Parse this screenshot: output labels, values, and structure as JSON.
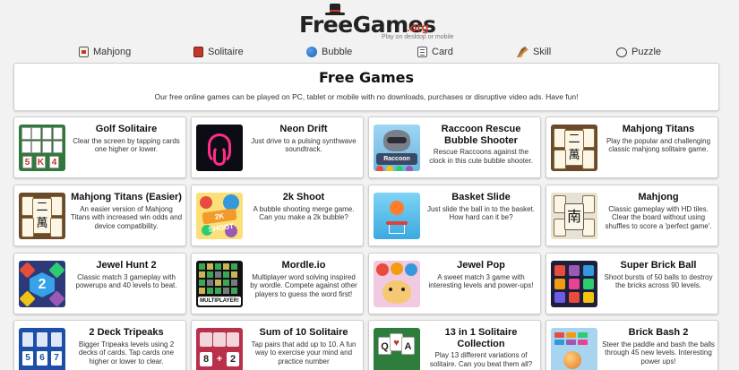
{
  "logo": {
    "main": "FreeGames",
    "ext": ".org",
    "tagline": "Play on desktop or mobile"
  },
  "nav": [
    {
      "label": "Mahjong",
      "icon": "mahjong-tile-icon"
    },
    {
      "label": "Solitaire",
      "icon": "card-back-icon"
    },
    {
      "label": "Bubble",
      "icon": "bubble-icon"
    },
    {
      "label": "Card",
      "icon": "card-icon"
    },
    {
      "label": "Skill",
      "icon": "skill-icon"
    },
    {
      "label": "Puzzle",
      "icon": "puzzle-icon"
    }
  ],
  "hero": {
    "title": "Free Games",
    "subtitle": "Our free online games can be played on PC, tablet or mobile with no downloads, purchases or disruptive video ads. Have fun!"
  },
  "games": [
    {
      "title": "Golf Solitaire",
      "desc": "Clear the screen by tapping cards one higher or lower.",
      "thumb": "golf",
      "thumb_text": [
        "5",
        "K",
        "4"
      ]
    },
    {
      "title": "Neon Drift",
      "desc": "Just drive to a pulsing synthwave soundtrack.",
      "thumb": "neon"
    },
    {
      "title": "Raccoon Rescue Bubble Shooter",
      "desc": "Rescue Raccoons against the clock in this cute bubble shooter.",
      "thumb": "raccoon",
      "thumb_text": [
        "Raccoon"
      ]
    },
    {
      "title": "Mahjong Titans",
      "desc": "Play the popular and challenging classic mahjong solitaire game.",
      "thumb": "mahjong",
      "thumb_text": [
        "二",
        "萬"
      ]
    },
    {
      "title": "Mahjong Titans (Easier)",
      "desc": "An easier version of Mahjong Titans with increased win odds and device compatibility.",
      "thumb": "mahjong",
      "thumb_text": [
        "二",
        "萬"
      ]
    },
    {
      "title": "2k Shoot",
      "desc": "A bubble shooting merge game. Can you make a 2k bubble?",
      "thumb": "shoot",
      "thumb_text": [
        "2K SHOOT"
      ]
    },
    {
      "title": "Basket Slide",
      "desc": "Just slide the ball in to the basket. How hard can it be?",
      "thumb": "basket"
    },
    {
      "title": "Mahjong",
      "desc": "Classic gameplay with HD tiles. Clear the board without using shuffles to score a 'perfect game'.",
      "thumb": "mj2",
      "thumb_text": [
        "南"
      ]
    },
    {
      "title": "Jewel Hunt 2",
      "desc": "Classic match 3 gameplay with powerups and 40 levels to beat.",
      "thumb": "jewel",
      "thumb_text": [
        "2"
      ]
    },
    {
      "title": "Mordle.io",
      "desc": "Multiplayer word solving inspired by wordle. Compete against other players to guess the word first!",
      "thumb": "wordle",
      "thumb_text": [
        "MULTIPLAYER!"
      ]
    },
    {
      "title": "Jewel Pop",
      "desc": "A sweet match 3 game with interesting levels and power-ups!",
      "thumb": "pop"
    },
    {
      "title": "Super Brick Ball",
      "desc": "Shoot bursts of 50 balls to destroy the bricks across 90 levels.",
      "thumb": "brick"
    },
    {
      "title": "2 Deck Tripeaks",
      "desc": "Bigger Tripeaks levels using 2 decks of cards. Tap cards one higher or lower to clear.",
      "thumb": "tri",
      "thumb_text": [
        "5",
        "6",
        "7"
      ]
    },
    {
      "title": "Sum of 10 Solitaire",
      "desc": "Tap pairs that add up to 10. A fun way to exercise your mind and practice number",
      "thumb": "sum",
      "thumb_text": [
        "8",
        "+",
        "2"
      ]
    },
    {
      "title": "13 in 1 Solitaire Collection",
      "desc": "Play 13 different variations of solitaire. Can you beat them all?",
      "thumb": "13",
      "thumb_text": [
        "Q",
        "A"
      ]
    },
    {
      "title": "Brick Bash 2",
      "desc": "Steer the paddle and bash the balls through 45 new levels. Interesting power ups!",
      "thumb": "bash"
    }
  ],
  "colors": {
    "background": "#f2f2f2",
    "card_bg": "#ffffff",
    "logo_ext": "#d03a2c"
  }
}
